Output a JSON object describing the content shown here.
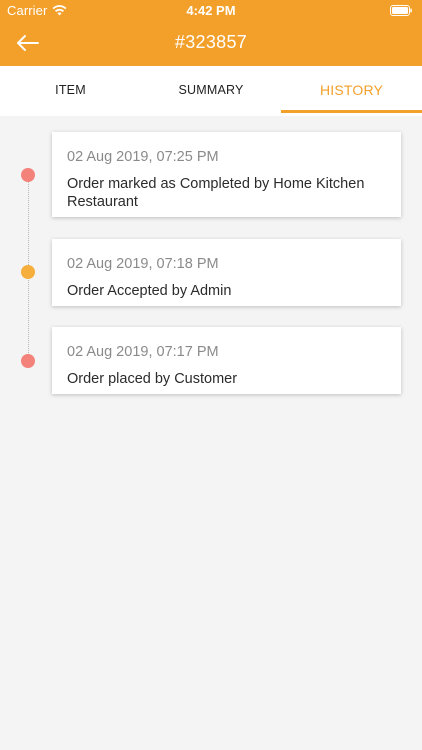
{
  "status_bar": {
    "carrier": "Carrier",
    "time": "4:42 PM"
  },
  "nav": {
    "title": "#323857",
    "back_icon": "arrow-left-icon"
  },
  "tabs": [
    {
      "label": "ITEM",
      "active": false
    },
    {
      "label": "SUMMARY",
      "active": false
    },
    {
      "label": "HISTORY",
      "active": true
    }
  ],
  "history": [
    {
      "time": "02 Aug 2019, 07:25 PM",
      "description": "Order marked as Completed by Home Kitchen Restaurant",
      "dot_color": "#f3827a"
    },
    {
      "time": "02 Aug 2019, 07:18 PM",
      "description": "Order Accepted by Admin",
      "dot_color": "#f6ae3c"
    },
    {
      "time": "02 Aug 2019, 07:17 PM",
      "description": "Order placed by Customer",
      "dot_color": "#f3827a"
    }
  ],
  "colors": {
    "accent": "#f3a02a",
    "background": "#f4f4f4"
  }
}
